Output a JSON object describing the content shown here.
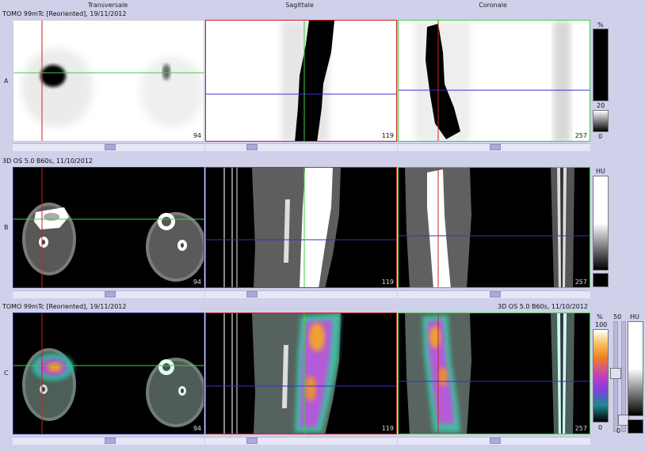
{
  "headers": {
    "transverse": "Transversale",
    "sagittal": "Sagittale",
    "coronal": "Coronale"
  },
  "rows": [
    {
      "letter": "A",
      "series": "TOMO 99mTc [Reoriented], 19/11/2012",
      "slices": [
        "94",
        "119",
        "257"
      ],
      "scale": {
        "unit": "%",
        "value": "20",
        "min": "0"
      }
    },
    {
      "letter": "B",
      "series": "3D OS 5.0 B60s, 11/10/2012",
      "slices": [
        "94",
        "119",
        "257"
      ],
      "scale": {
        "unit": "HU"
      }
    },
    {
      "letter": "C",
      "series": "TOMO 99mTc [Reoriented], 19/11/2012",
      "series_right": "3D OS 5.0 B60s, 11/10/2012",
      "slices": [
        "94",
        "119",
        "257"
      ],
      "scale": {
        "unit": "%",
        "max": "100",
        "min": "0",
        "unit2": "HU",
        "value2": "50",
        "min2": "0"
      }
    }
  ],
  "colors": {
    "transverse_frame": "#2a2a8c",
    "sagittal_frame": "#cc2222",
    "coronal_frame": "#44bb44"
  }
}
